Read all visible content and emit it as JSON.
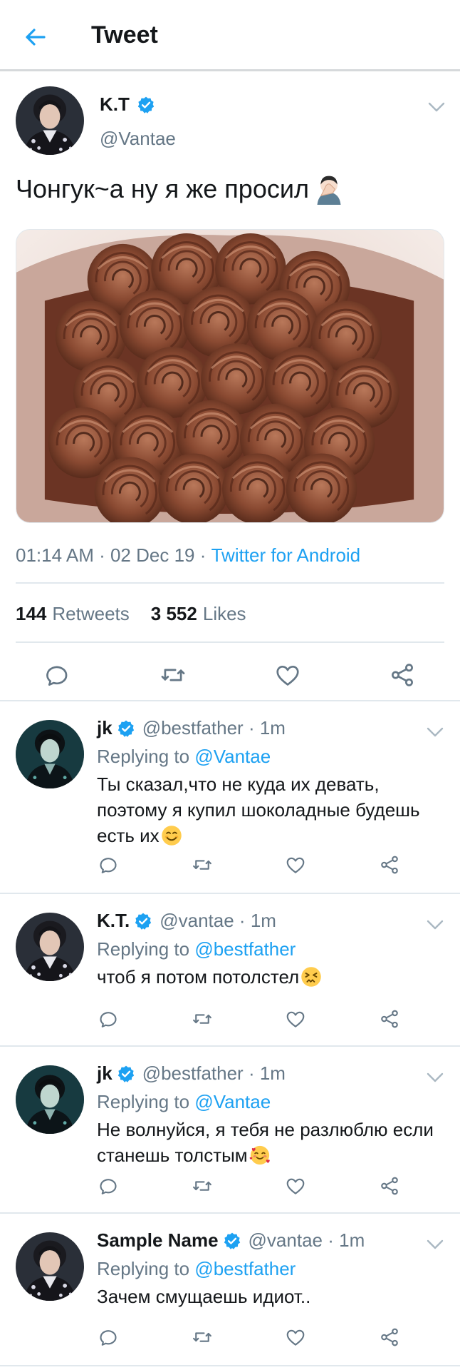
{
  "header": {
    "title": "Tweet"
  },
  "main_tweet": {
    "name": "K.T",
    "handle": "@Vantae",
    "text": "Чонгук~а ну я же просил",
    "time": "01:14 AM",
    "date": "02 Dec 19",
    "source": "Twitter for Android",
    "separator": " · ",
    "retweets_count": "144",
    "retweets_label": "Retweets",
    "likes_count": "3 552",
    "likes_label": "Likes"
  },
  "replies": [
    {
      "name": "jk",
      "handle": "@bestfather",
      "time": "1m",
      "replying_prefix": "Replying to",
      "replying_to": "@Vantae",
      "text": "Ты сказал,что не куда их девать, поэтому я купил шоколадные будешь есть их",
      "emoji": "smiling-face-icon"
    },
    {
      "name": "K.T.",
      "handle": "@vantae",
      "time": "1m",
      "replying_prefix": "Replying to",
      "replying_to": "@bestfather",
      "text": "чтоб я потом потолстел",
      "emoji": "persevering-face-icon"
    },
    {
      "name": "jk",
      "handle": "@bestfather",
      "time": "1m",
      "replying_prefix": "Replying to",
      "replying_to": "@Vantae",
      "text": "Не волнуйся, я тебя не разлюблю если станешь толстым",
      "emoji": "smiling-face-with-hearts-icon"
    },
    {
      "name": "Sample Name",
      "handle": "@vantae",
      "time": "1m",
      "replying_prefix": "Replying to",
      "replying_to": "@bestfather",
      "text": "Зачем смущаешь идиот..",
      "emoji": ""
    }
  ],
  "icons": {
    "back": "arrow-left-icon",
    "verified": "verified-badge-icon",
    "caret": "chevron-down-icon",
    "reply": "comment-icon",
    "retweet": "retweet-icon",
    "like": "heart-icon",
    "share": "share-icon"
  },
  "colors": {
    "accent": "#1da1f2",
    "text": "#14171a",
    "secondary": "#657786",
    "divider": "#e1e8ed"
  }
}
